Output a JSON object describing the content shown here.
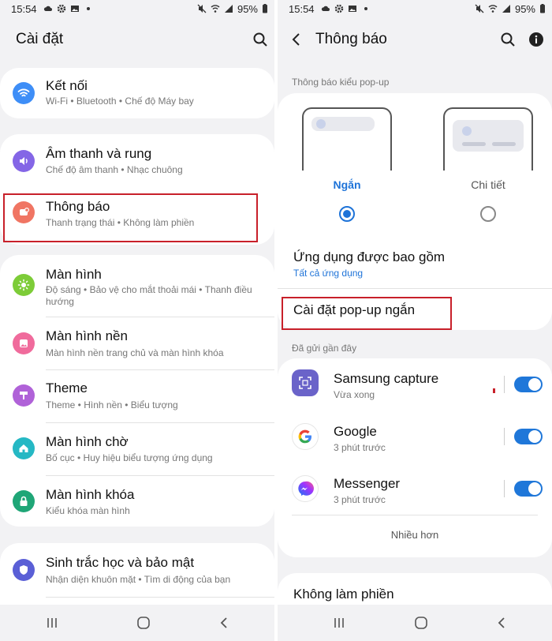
{
  "status": {
    "time": "15:54",
    "battery": "95%"
  },
  "left": {
    "title": "Cài đặt",
    "items": [
      {
        "title": "Kết nối",
        "sub": "Wi-Fi  •  Bluetooth  •  Chế độ Máy bay",
        "icon": "wifi-icon",
        "color": "#3e8ef7"
      },
      {
        "title": "Âm thanh và rung",
        "sub": "Chế độ âm thanh  •  Nhạc chuông",
        "icon": "volume-icon",
        "color": "#8466e6"
      },
      {
        "title": "Thông báo",
        "sub": "Thanh trạng thái  •  Không làm phiền",
        "icon": "notification-icon",
        "color": "#f07563"
      },
      {
        "title": "Màn hình",
        "sub": "Độ sáng  •  Bảo vệ cho mắt thoải mái  •  Thanh điều hướng",
        "icon": "brightness-icon",
        "color": "#7dcc38"
      },
      {
        "title": "Màn hình nền",
        "sub": "Màn hình nền trang chủ và màn hình khóa",
        "icon": "wallpaper-icon",
        "color": "#f06b9c"
      },
      {
        "title": "Theme",
        "sub": "Theme  •  Hình nền  •  Biểu tượng",
        "icon": "theme-icon",
        "color": "#b062d8"
      },
      {
        "title": "Màn hình chờ",
        "sub": "Bố cục  •  Huy hiệu biểu tượng ứng dụng",
        "icon": "home-icon",
        "color": "#25b8c4"
      },
      {
        "title": "Màn hình khóa",
        "sub": "Kiểu khóa màn hình",
        "icon": "lock-icon",
        "color": "#1fa677"
      },
      {
        "title": "Sinh trắc học và bảo mật",
        "sub": "Nhận diện khuôn mặt  •  Tìm di động của bạn",
        "icon": "shield-icon",
        "color": "#5a5fd6"
      }
    ]
  },
  "right": {
    "title": "Thông báo",
    "popup_section": "Thông báo kiểu pop-up",
    "option_brief": "Ngắn",
    "option_detailed": "Chi tiết",
    "included_apps_title": "Ứng dụng được bao gồm",
    "included_apps_value": "Tất cả ứng dụng",
    "brief_settings": "Cài đặt pop-up ngắn",
    "recent_section": "Đã gửi gần đây",
    "apps": [
      {
        "name": "Samsung capture",
        "time": "Vừa xong",
        "icon": "capture-icon"
      },
      {
        "name": "Google",
        "time": "3 phút trước",
        "icon": "google-icon"
      },
      {
        "name": "Messenger",
        "time": "3 phút trước",
        "icon": "messenger-icon"
      }
    ],
    "more": "Nhiều hơn",
    "dnd": "Không làm phiền"
  },
  "colors": {
    "accent": "#1e73d8",
    "highlight": "#c8202a"
  }
}
